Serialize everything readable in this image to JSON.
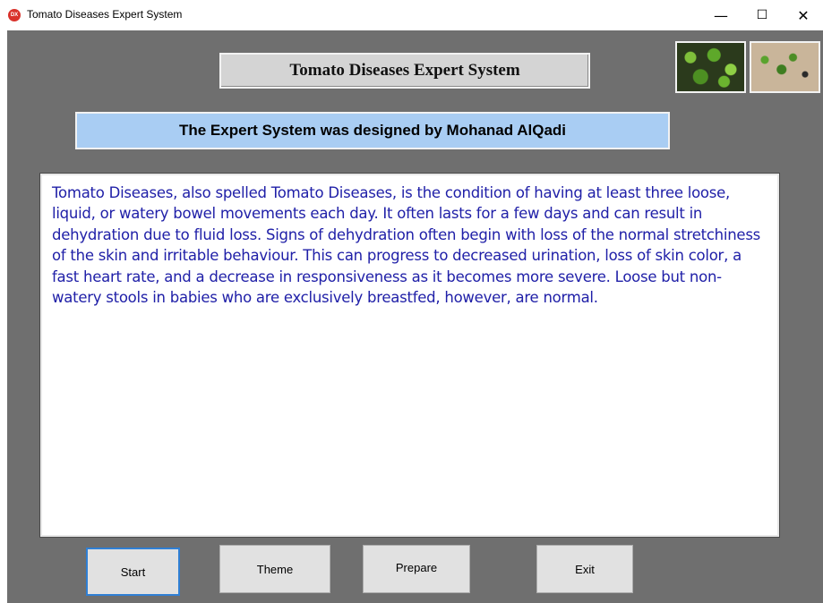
{
  "window": {
    "title": "Tomato Diseases Expert System",
    "app_icon": "DX",
    "minimize_glyph": "—",
    "maximize_glyph": "☐",
    "close_glyph": "✕"
  },
  "header": {
    "title": "Tomato Diseases Expert System",
    "designer_credit": "The Expert System was designed by Mohanad AlQadi"
  },
  "images": [
    {
      "icon": "tomato-seedlings-image"
    },
    {
      "icon": "diseased-seedlings-image"
    }
  ],
  "description": "Tomato Diseases, also spelled Tomato Diseases, is the condition of having at least three loose, liquid, or watery bowel movements each day. It often lasts for a few days and can result in dehydration due to fluid loss. Signs of dehydration often begin with loss of the normal stretchiness of the skin and irritable behaviour. This can progress to decreased urination, loss of skin color, a fast heart rate, and a decrease in responsiveness as it becomes more severe. Loose but non-watery stools in babies who are exclusively breastfed, however, are normal.",
  "buttons": {
    "start": "Start",
    "theme": "Theme",
    "prepare": "Prepare",
    "exit": "Exit"
  },
  "colors": {
    "client_background": "#6f6f6f",
    "header_box": "#d4d4d4",
    "credit_box": "#a9cdf3",
    "description_text": "#2020a8",
    "focused_button_border": "#2f7fd4",
    "close_icon": "#d9322b"
  }
}
